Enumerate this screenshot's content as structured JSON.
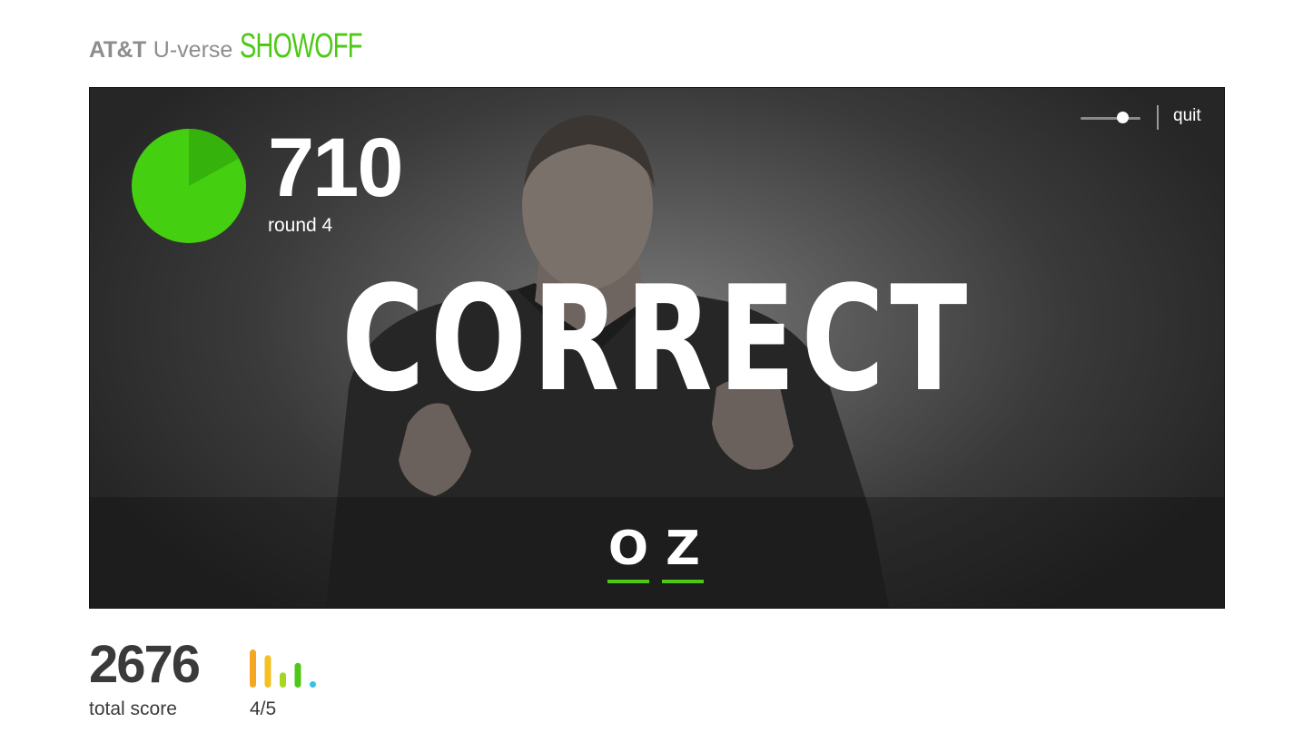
{
  "header": {
    "logo_att": "AT&T",
    "logo_uverse": "U-verse",
    "logo_showoff": "SHOWOFF"
  },
  "stage": {
    "round_score": "710",
    "round_label": "round 4",
    "timer_remaining_fraction": 0.83,
    "volume_level": 0.7,
    "quit_label": "quit",
    "feedback": "CORRECT",
    "answer_letters": [
      "O",
      "Z"
    ]
  },
  "footer": {
    "total_score": "2676",
    "total_label": "total score",
    "progress_label": "4/5",
    "round_bars": [
      {
        "color": "#f5a623",
        "level": 1.0
      },
      {
        "color": "#f5c023",
        "level": 0.85
      },
      {
        "color": "#a8d620",
        "level": 0.4
      },
      {
        "color": "#4cc815",
        "level": 0.65
      },
      {
        "color": "#35c0e8",
        "level": 0.0
      }
    ]
  },
  "colors": {
    "accent_green": "#4cc815",
    "pie_light": "#44d010",
    "pie_dark": "#36b20c"
  }
}
